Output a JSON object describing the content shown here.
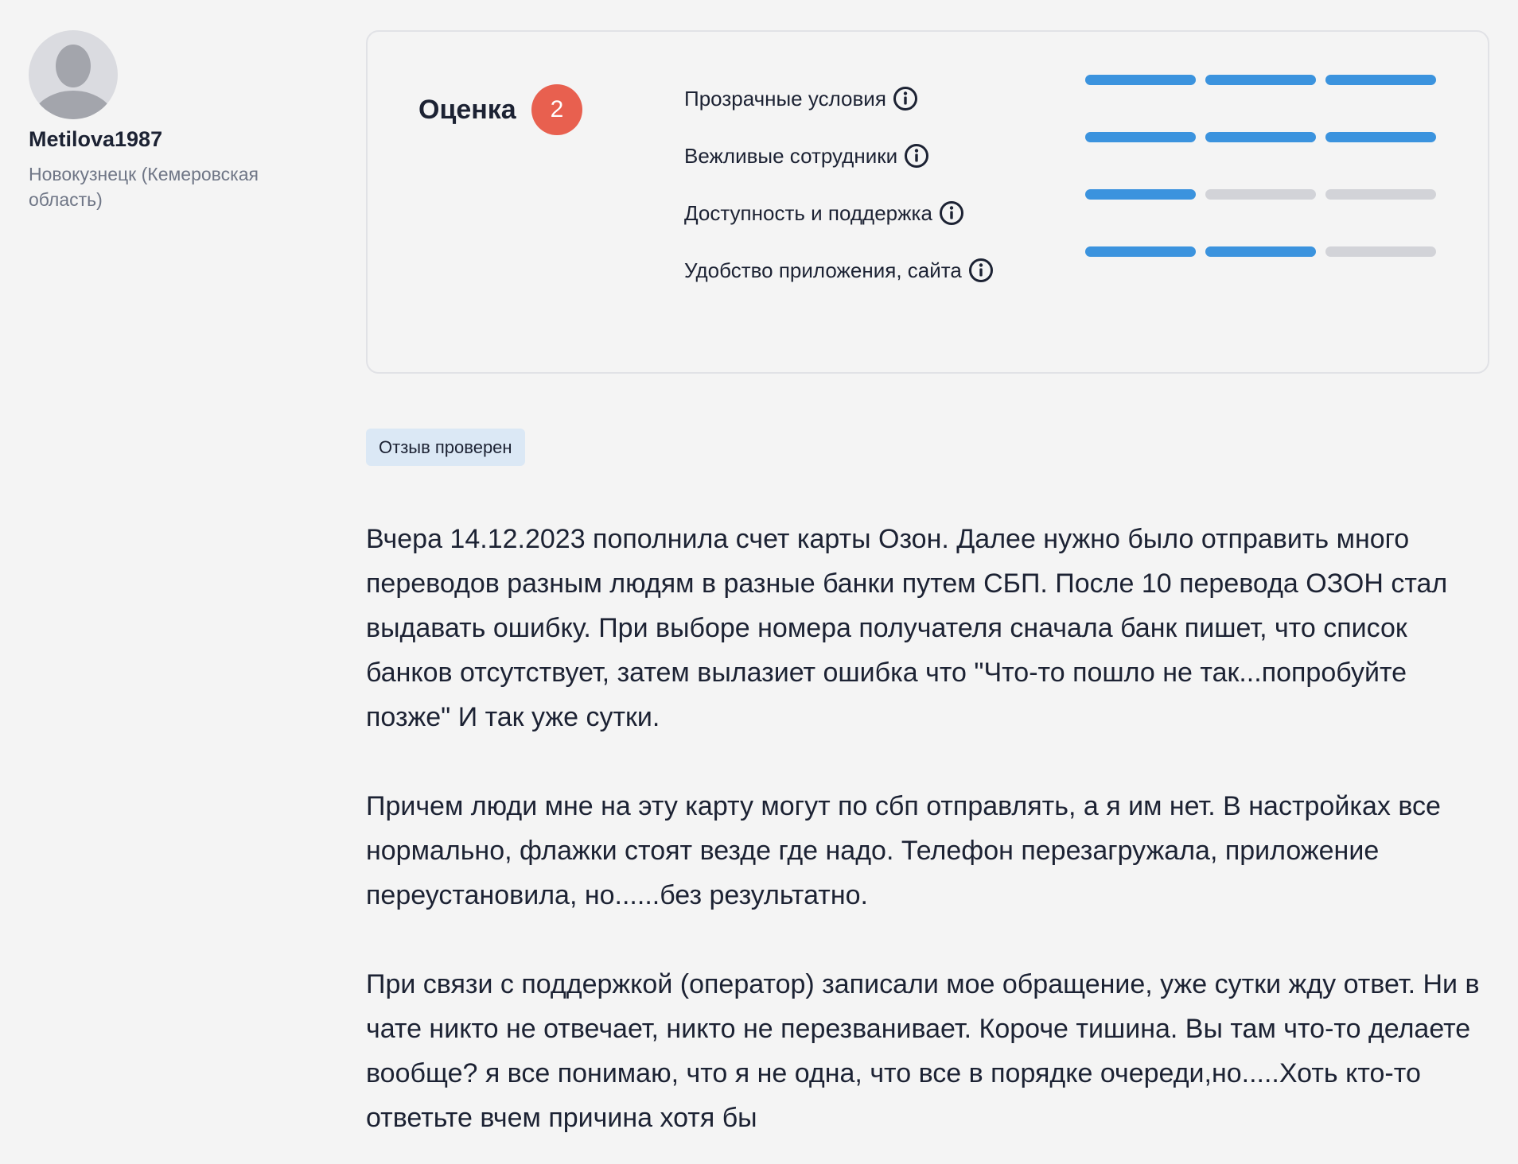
{
  "author": {
    "name": "Metilova1987",
    "city": "Новокузнецк (Кемеровская область)",
    "avatar_icon": "user-placeholder-icon"
  },
  "rating": {
    "label": "Оценка",
    "score": "2",
    "badge_color": "#e8604f",
    "bar_active_color": "#3b93de",
    "bar_inactive_color": "#d2d3d8",
    "criteria": [
      {
        "label": "Прозрачные условия",
        "filled": 3,
        "total": 3,
        "icon": "info-icon"
      },
      {
        "label": "Вежливые сотрудники",
        "filled": 3,
        "total": 3,
        "icon": "info-icon"
      },
      {
        "label": "Доступность и поддержка",
        "filled": 1,
        "total": 3,
        "icon": "info-icon"
      },
      {
        "label": "Удобство приложения, сайта",
        "filled": 2,
        "total": 3,
        "icon": "info-icon"
      }
    ]
  },
  "verified_badge": "Отзыв проверен",
  "review": {
    "paragraphs": [
      "Вчера 14.12.2023 пополнила счет карты Озон. Далее нужно было отправить много переводов разным людям в разные банки путем СБП. После 10 перевода ОЗОН стал выдавать ошибку. При выборе номера получателя сначала банк пишет, что список банков отсутствует, затем вылазиет ошибка что \"Что-то пошло не так...попробуйте позже\" И так уже сутки.",
      "Причем люди мне на эту карту могут по сбп отправлять, а я им нет. В настройках все нормально, флажки стоят везде где надо. Телефон перезагружала, приложение переустановила, но......без результатно.",
      "При связи с поддержкой (оператор) записали мое обращение, уже сутки жду ответ. Ни в чате никто не отвечает, никто не перезванивает. Короче тишина. Вы там что-то делаете вообще? я все понимаю, что я не одна, что все в порядке очереди,но.....Хоть кто-то ответьте вчем причина хотя бы"
    ]
  }
}
